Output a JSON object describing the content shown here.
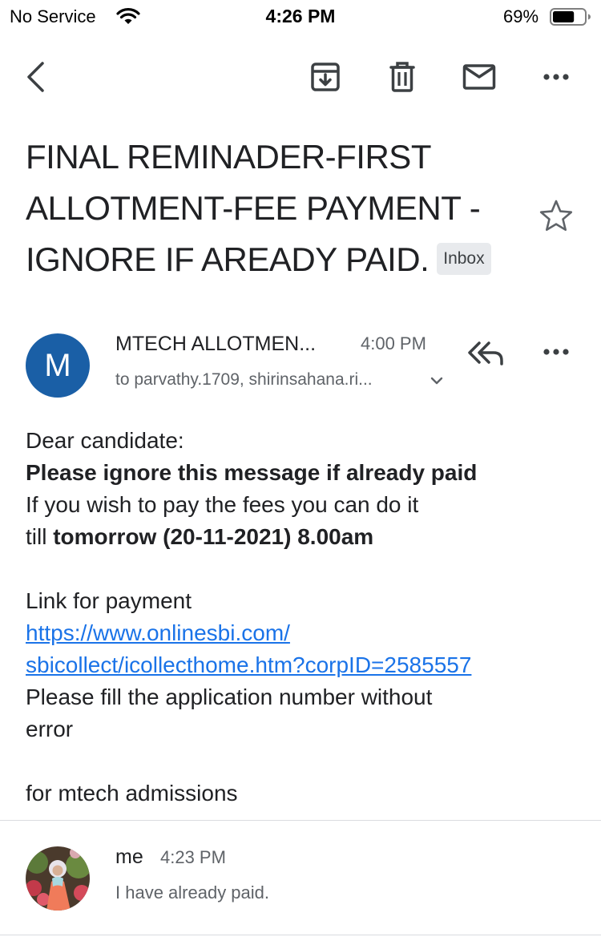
{
  "status_bar": {
    "carrier": "No Service",
    "time": "4:26 PM",
    "battery_percent": "69%",
    "battery_level": 0.69
  },
  "toolbar": {
    "back_icon": "chevron-left-icon",
    "archive_icon": "archive-icon",
    "delete_icon": "trash-icon",
    "mark_unread_icon": "mail-icon",
    "more_icon": "more-horizontal-icon"
  },
  "email": {
    "subject_lines": [
      "FINAL REMINADER-FIRST",
      "ALLOTMENT-FEE PAYMENT -",
      "IGNORE IF AREADY PAID."
    ],
    "label": "Inbox",
    "starred": false
  },
  "message": {
    "avatar_letter": "M",
    "avatar_color": "#1a5fa6",
    "sender": "MTECH ALLOTMEN...",
    "time": "4:00 PM",
    "recipients": "to parvathy.1709, shirinsahana.ri...",
    "body": {
      "greeting": "Dear candidate:",
      "ignore_notice": "Please ignore this message  if already paid",
      "pay_line_1": "If you wish to pay the fees you can do it",
      "till": "till ",
      "deadline": "tomorrow (20-11-2021)  8.00am",
      "link_intro": "Link for payment",
      "link_line_1": "https://www.onlinesbi.com/",
      "link_line_2": "sbicollect/icollecthome.htm?corpID=2585557",
      "fill_line_1": "Please fill the application number without",
      "fill_line_2": "error",
      "signoff": "for mtech admissions"
    }
  },
  "reply": {
    "sender": "me",
    "time": "4:23 PM",
    "snippet": "I have already paid."
  },
  "colors": {
    "link": "#1a73e8",
    "secondary_text": "#5f6368",
    "chip_bg": "#e8eaed"
  }
}
